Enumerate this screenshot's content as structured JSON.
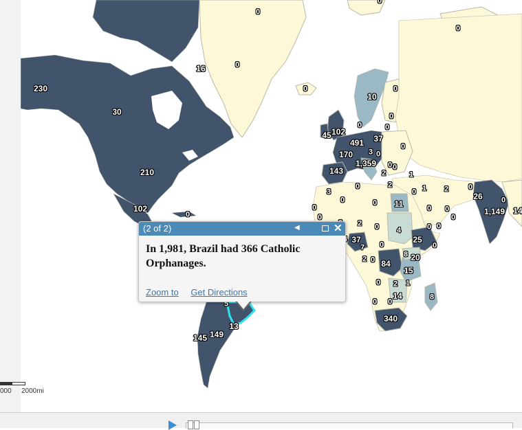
{
  "map": {
    "colors": {
      "ocean": "#ffffff",
      "dark": "#41546c",
      "medium": "#9ab9c4",
      "light": "#c9dcd4",
      "zero": "#fdf8d7",
      "border": "#b8b8a8",
      "highlight": "#2ee3f0"
    },
    "labels": [
      {
        "text": "0"
      },
      {
        "text": "0"
      },
      {
        "text": "0"
      },
      {
        "text": "16"
      },
      {
        "text": "0"
      },
      {
        "text": "230"
      },
      {
        "text": "0"
      },
      {
        "text": "10"
      },
      {
        "text": "0"
      },
      {
        "text": "30"
      },
      {
        "text": "0"
      },
      {
        "text": "0"
      },
      {
        "text": "0"
      },
      {
        "text": "45"
      },
      {
        "text": "102"
      },
      {
        "text": "37"
      },
      {
        "text": "491"
      },
      {
        "text": "0"
      },
      {
        "text": "170"
      },
      {
        "text": "3"
      },
      {
        "text": "0"
      },
      {
        "text": "1,359"
      },
      {
        "text": "210"
      },
      {
        "text": "0"
      },
      {
        "text": "143"
      },
      {
        "text": "2"
      },
      {
        "text": "0"
      },
      {
        "text": "1"
      },
      {
        "text": "2"
      },
      {
        "text": "3"
      },
      {
        "text": "0"
      },
      {
        "text": "1"
      },
      {
        "text": "2"
      },
      {
        "text": "0"
      },
      {
        "text": "26"
      },
      {
        "text": "0"
      },
      {
        "text": "102"
      },
      {
        "text": "0"
      },
      {
        "text": "0"
      },
      {
        "text": "0"
      },
      {
        "text": "11"
      },
      {
        "text": "0"
      },
      {
        "text": "0"
      },
      {
        "text": "1,149"
      },
      {
        "text": "14"
      },
      {
        "text": "0"
      },
      {
        "text": "0"
      },
      {
        "text": "0"
      },
      {
        "text": "0"
      },
      {
        "text": "0"
      },
      {
        "text": "2"
      },
      {
        "text": "0"
      },
      {
        "text": "4"
      },
      {
        "text": "0"
      },
      {
        "text": "0"
      },
      {
        "text": "37"
      },
      {
        "text": "25"
      },
      {
        "text": "4"
      },
      {
        "text": "7"
      },
      {
        "text": "0"
      },
      {
        "text": "0"
      },
      {
        "text": "2"
      },
      {
        "text": "0"
      },
      {
        "text": "84"
      },
      {
        "text": "8"
      },
      {
        "text": "20"
      },
      {
        "text": "15"
      },
      {
        "text": "0"
      },
      {
        "text": "2"
      },
      {
        "text": "1"
      },
      {
        "text": "14"
      },
      {
        "text": "8"
      },
      {
        "text": "0"
      },
      {
        "text": "0"
      },
      {
        "text": "340"
      },
      {
        "text": "5"
      },
      {
        "text": "13"
      },
      {
        "text": "145"
      },
      {
        "text": "149"
      }
    ],
    "scale": {
      "left_label": "000",
      "right_label": "2000mi"
    }
  },
  "popup": {
    "pager": "(2 of 2)",
    "prev_icon": "◀",
    "close_icon": "✕",
    "text": "In 1,981, Brazil had 366 Catholic Orphanages.",
    "zoom_to": "Zoom to",
    "get_directions": "Get Directions"
  },
  "timebar": {
    "play_icon": "play-icon"
  }
}
